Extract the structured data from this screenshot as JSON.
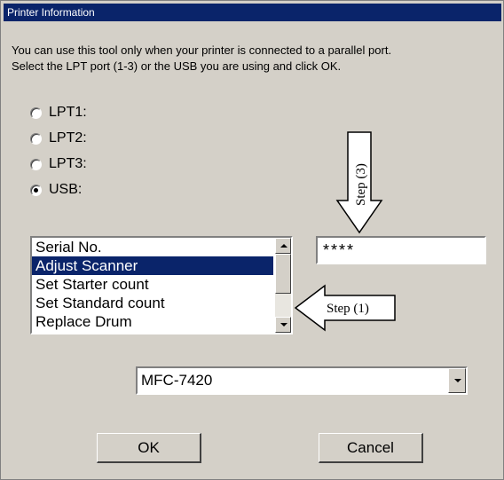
{
  "window": {
    "title": "Printer Information"
  },
  "description": {
    "line1": "You can use this tool only when your printer is connected to a parallel port.",
    "line2": "Select the LPT port (1-3) or the USB you are using and click OK."
  },
  "ports": {
    "options": [
      {
        "label": "LPT1:",
        "checked": false
      },
      {
        "label": "LPT2:",
        "checked": false
      },
      {
        "label": "LPT3:",
        "checked": false
      },
      {
        "label": "USB:",
        "checked": true
      }
    ]
  },
  "list": {
    "items": [
      {
        "label": "Serial No.",
        "selected": false
      },
      {
        "label": "Adjust Scanner",
        "selected": true
      },
      {
        "label": "Set Starter count",
        "selected": false
      },
      {
        "label": "Set Standard count",
        "selected": false
      },
      {
        "label": "Replace Drum",
        "selected": false
      }
    ]
  },
  "code_field": {
    "value": "****"
  },
  "model_select": {
    "value": "MFC-7420"
  },
  "buttons": {
    "ok": "OK",
    "cancel": "Cancel"
  },
  "annotations": {
    "step1": "Step (1)",
    "step3": "Step (3)"
  },
  "colors": {
    "dialog_face": "#d4d0c8",
    "title_bar": "#0a246a",
    "selection": "#0a246a"
  }
}
